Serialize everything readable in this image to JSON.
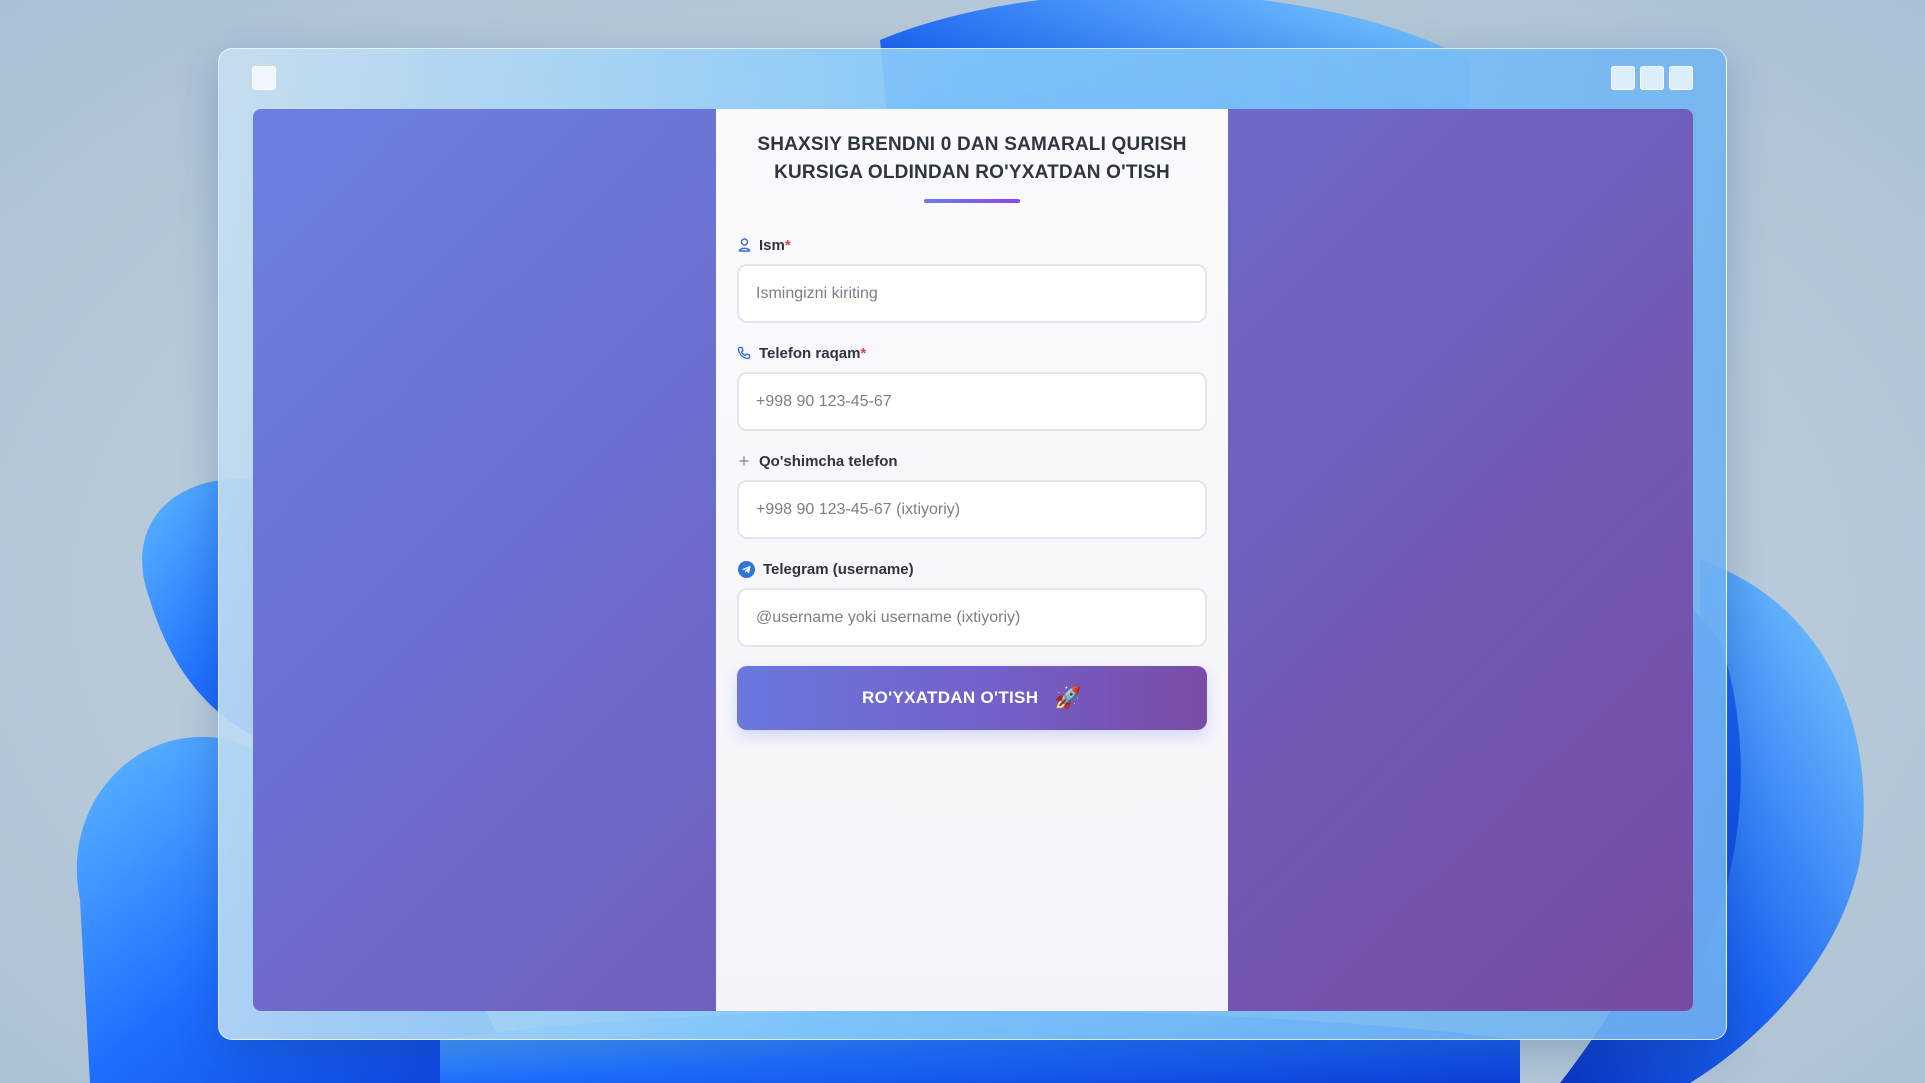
{
  "form": {
    "title": "SHAXSIY BRENDNI 0 DAN SAMARALI QURISH KURSIGA OLDINDAN RO'YXATDAN O'TISH",
    "fields": [
      {
        "label": "Ism",
        "required_mark": "*",
        "placeholder": "Ismingizni kiriting",
        "value": "",
        "icon": "user-icon"
      },
      {
        "label": "Telefon raqam",
        "required_mark": "*",
        "placeholder": "+998 90 123-45-67",
        "value": "",
        "icon": "phone-icon"
      },
      {
        "label": "Qo'shimcha telefon",
        "required_mark": "",
        "placeholder": "+998 90 123-45-67 (ixtiyoriy)",
        "value": "",
        "icon": "plus-icon"
      },
      {
        "label": "Telegram (username)",
        "required_mark": "",
        "placeholder": "@username yoki username (ixtiyoriy)",
        "value": "",
        "icon": "telegram-icon"
      }
    ],
    "submit": {
      "label": "RO'YXATDAN O'TISH",
      "emoji": "🚀"
    }
  },
  "colors": {
    "gradient_start": "#667eea",
    "gradient_end": "#764ba2",
    "required": "#e53e4f",
    "icon_blue": "#3b6fd8"
  }
}
